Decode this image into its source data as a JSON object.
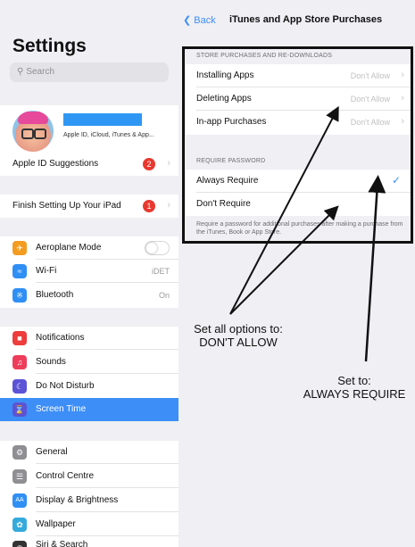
{
  "sidebar": {
    "title": "Settings",
    "search_placeholder": "Search",
    "profile": {
      "subtitle": "Apple ID, iCloud, iTunes & App..."
    },
    "items": [
      {
        "label": "Apple ID Suggestions",
        "badge": "2"
      },
      {
        "label": "Finish Setting Up Your iPad",
        "badge": "1"
      },
      {
        "label": "Aeroplane Mode",
        "icon": "airplane-icon",
        "color": "#f39c20",
        "toggle": false
      },
      {
        "label": "Wi-Fi",
        "icon": "wifi-icon",
        "color": "#2f8ff5",
        "value": "iDET"
      },
      {
        "label": "Bluetooth",
        "icon": "bluetooth-icon",
        "color": "#2f8ff5",
        "value": "On"
      },
      {
        "label": "Notifications",
        "icon": "notifications-icon",
        "color": "#ee3d3d"
      },
      {
        "label": "Sounds",
        "icon": "sounds-icon",
        "color": "#ee3d5a"
      },
      {
        "label": "Do Not Disturb",
        "icon": "moon-icon",
        "color": "#5c53d6"
      },
      {
        "label": "Screen Time",
        "icon": "hourglass-icon",
        "color": "#5c53d6",
        "selected": true
      },
      {
        "label": "General",
        "icon": "gear-icon",
        "color": "#8e8e93"
      },
      {
        "label": "Control Centre",
        "icon": "control-centre-icon",
        "color": "#8e8e93"
      },
      {
        "label": "Display & Brightness",
        "icon": "display-icon",
        "color": "#2f8ff5",
        "icon_text": "AA"
      },
      {
        "label": "Wallpaper",
        "icon": "wallpaper-icon",
        "color": "#34aadc"
      },
      {
        "label": "Siri & Search",
        "icon": "siri-icon",
        "color": "#333333"
      }
    ]
  },
  "nav": {
    "back_label": "Back",
    "title": "iTunes and App Store Purchases"
  },
  "store_section": {
    "header": "STORE PURCHASES AND RE-DOWNLOADS",
    "rows": [
      {
        "label": "Installing Apps",
        "value": "Don't Allow"
      },
      {
        "label": "Deleting Apps",
        "value": "Don't Allow"
      },
      {
        "label": "In-app Purchases",
        "value": "Don't Allow"
      }
    ]
  },
  "password_section": {
    "header": "REQUIRE PASSWORD",
    "rows": [
      {
        "label": "Always Require",
        "checked": true
      },
      {
        "label": "Don't Require",
        "checked": false
      }
    ],
    "footer": "Require a password for additional purchases after making a purchase from the iTunes, Book or App Store."
  },
  "annotations": {
    "left_line1": "Set all options to:",
    "left_line2": "DON'T ALLOW",
    "right_line1": "Set to:",
    "right_line2": "ALWAYS REQUIRE"
  },
  "colors": {
    "accent": "#3d8ef7",
    "badge": "#e8392f",
    "background": "#efeff4"
  }
}
